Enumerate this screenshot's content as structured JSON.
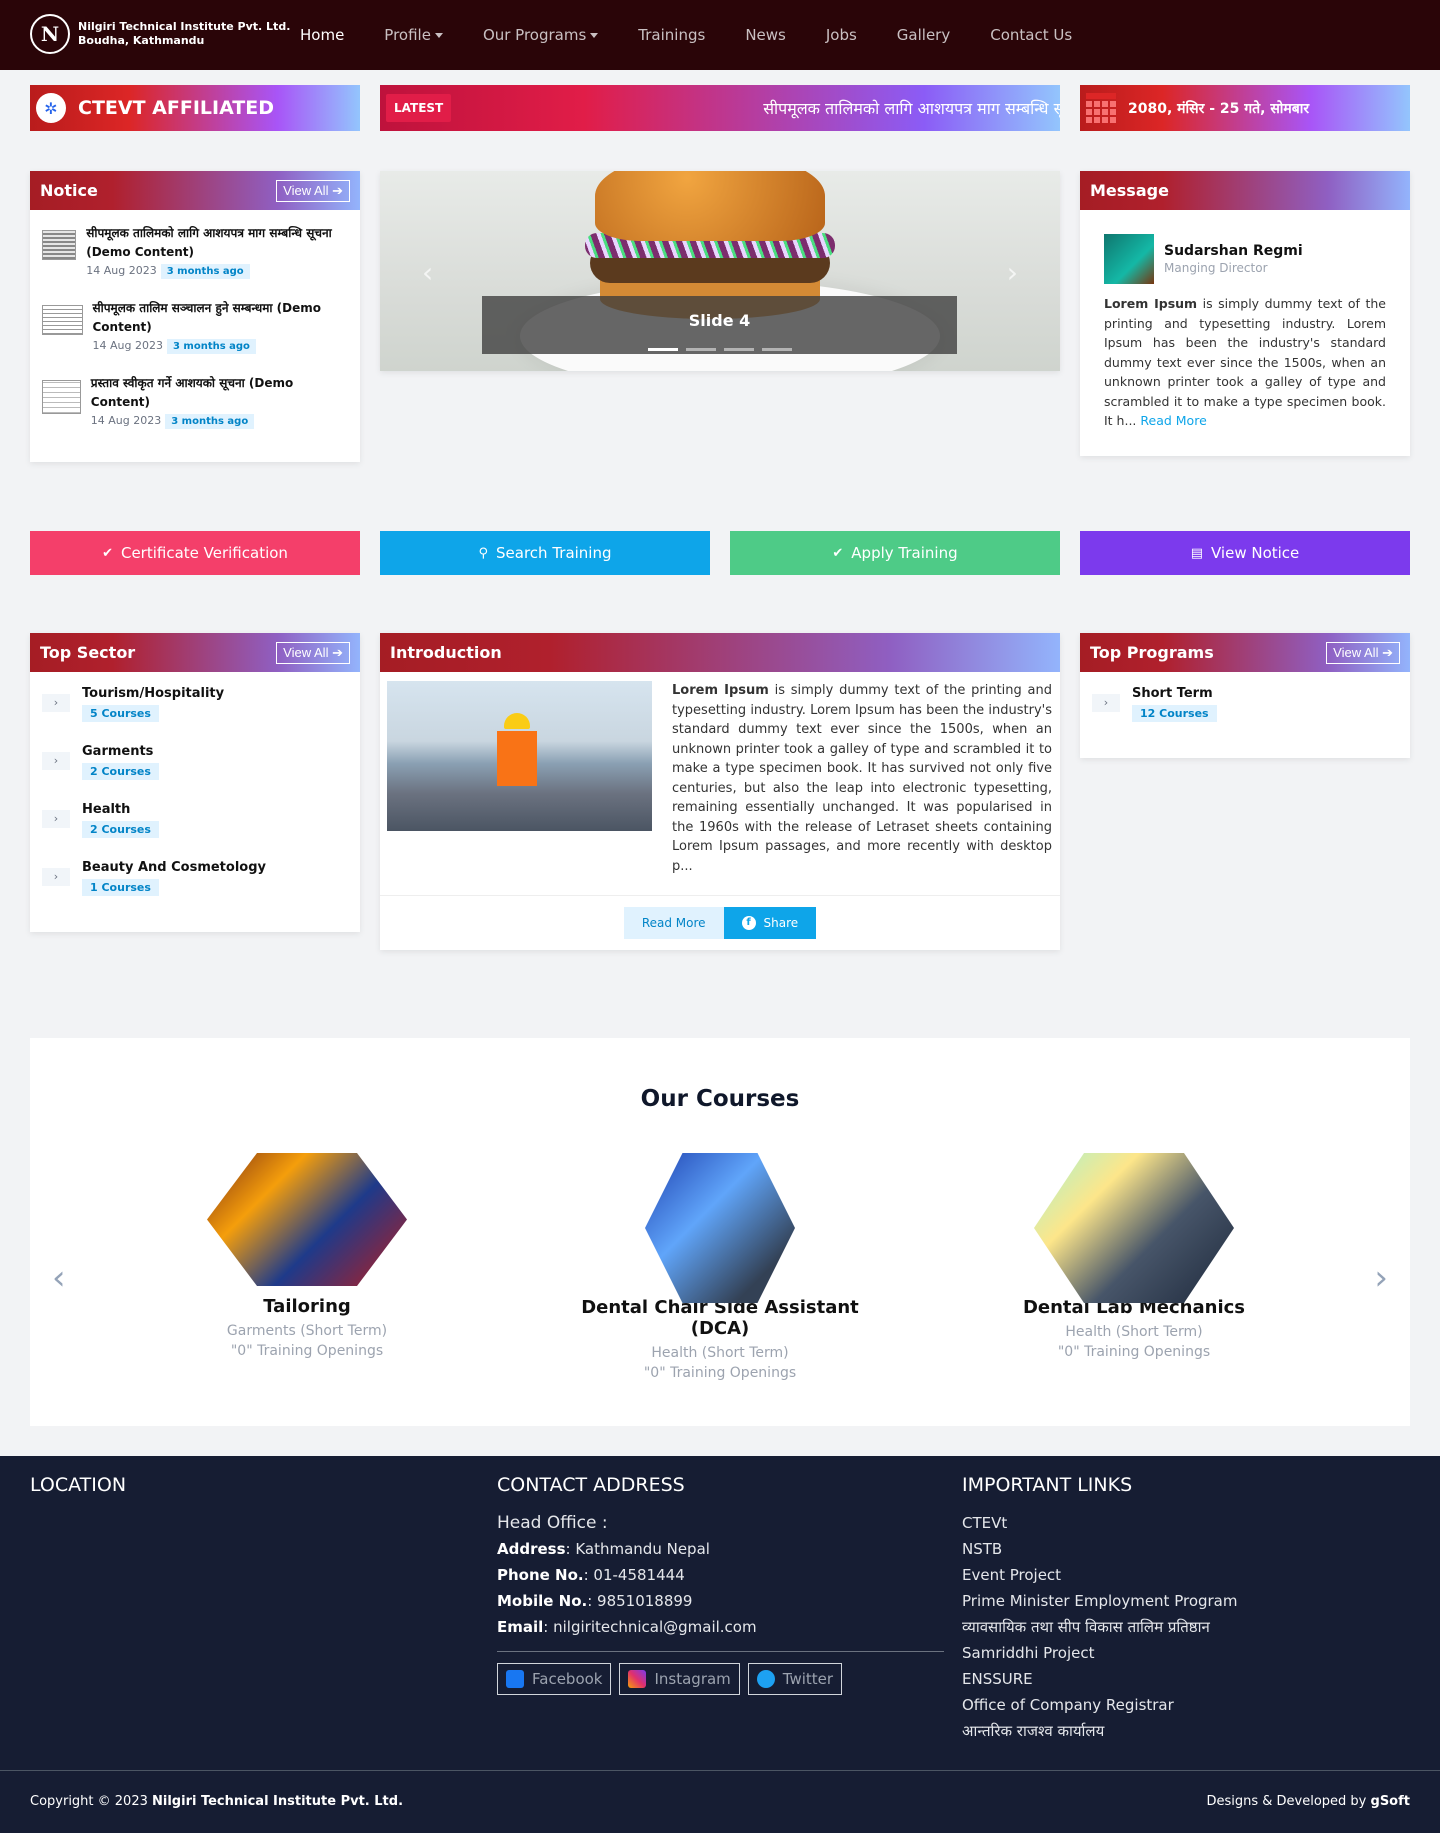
{
  "brand": {
    "name": "Nilgiri Technical Institute Pvt. Ltd.",
    "address": "Boudha, Kathmandu",
    "logo_letter": "N",
    "logo_word": "Nilgiri"
  },
  "nav": [
    {
      "label": "Home",
      "active": true
    },
    {
      "label": "Profile",
      "dropdown": true
    },
    {
      "label": "Our Programs",
      "dropdown": true
    },
    {
      "label": "Trainings"
    },
    {
      "label": "News"
    },
    {
      "label": "Jobs"
    },
    {
      "label": "Gallery"
    },
    {
      "label": "Contact Us"
    }
  ],
  "bars": {
    "ctevt": "CTEVT AFFILIATED",
    "latest_badge": "LATEST",
    "ticker": "सीपमूलक तालिमको लागि आशयपत्र माग सम्बन्धि सूचना",
    "date": "2080, मंसिर - 25 गते, सोमबार"
  },
  "notice": {
    "title": "Notice",
    "view_all": "View All",
    "items": [
      {
        "title": "सीपमूलक तालिमको लागि आशयपत्र माग सम्बन्धि सूचना (Demo Content)",
        "date": "14 Aug 2023",
        "ago": "3 months ago"
      },
      {
        "title": "सीपमूलक तालिम सञ्चालन हुने सम्बन्धमा (Demo Content)",
        "date": "14 Aug 2023",
        "ago": "3 months ago"
      },
      {
        "title": "प्रस्ताव स्वीकृत गर्ने आशयको सूचना (Demo Content)",
        "date": "14 Aug 2023",
        "ago": "3 months ago"
      }
    ]
  },
  "slider": {
    "caption": "Slide 4",
    "prev": "‹",
    "next": "›"
  },
  "message": {
    "title": "Message",
    "name": "Sudarshan Regmi",
    "role": "Manging Director",
    "lead": "Lorem Ipsum",
    "text": " is simply dummy text of the printing and typesetting industry. Lorem Ipsum has been the industry's standard dummy text ever since the 1500s, when an unknown printer took a galley of type and scrambled it to make a type specimen book. It h... ",
    "read_more": "Read More"
  },
  "actions": [
    {
      "label": "Certificate Verification",
      "icon": "✔",
      "color": "#f43f6a"
    },
    {
      "label": "Search Training",
      "icon": "⚲",
      "color": "#0ea5e9"
    },
    {
      "label": "Apply Training",
      "icon": "✔",
      "color": "#4ecb87"
    },
    {
      "label": "View Notice",
      "icon": "▤",
      "color": "#7c3aed"
    }
  ],
  "top_sector": {
    "title": "Top Sector",
    "view_all": "View All",
    "items": [
      {
        "name": "Tourism/Hospitality",
        "count": "5 Courses"
      },
      {
        "name": "Garments",
        "count": "2 Courses"
      },
      {
        "name": "Health",
        "count": "2 Courses"
      },
      {
        "name": "Beauty And Cosmetology",
        "count": "1 Courses"
      }
    ]
  },
  "intro": {
    "title": "Introduction",
    "lead": "Lorem Ipsum",
    "text": " is simply dummy text of the printing and typesetting industry. Lorem Ipsum has been the industry's standard dummy text ever since the 1500s, when an unknown printer took a galley of type and scrambled it to make a type specimen book. It has survived not only five centuries, but also the leap into electronic typesetting, remaining essentially unchanged. It was popularised in the 1960s with the release of Letraset sheets containing Lorem Ipsum passages, and more recently with desktop p...",
    "read_more": "Read More",
    "share": "Share"
  },
  "top_programs": {
    "title": "Top Programs",
    "view_all": "View All",
    "items": [
      {
        "name": "Short Term",
        "count": "12 Courses"
      }
    ]
  },
  "courses": {
    "title": "Our Courses",
    "items": [
      {
        "name": "Tailoring",
        "sector": "Garments (Short Term)",
        "openings": "\"0\" Training Openings"
      },
      {
        "name": "Dental Chair Side Assistant (DCA)",
        "sector": "Health (Short Term)",
        "openings": "\"0\" Training Openings"
      },
      {
        "name": "Dental Lab Mechanics",
        "sector": "Health (Short Term)",
        "openings": "\"0\" Training Openings"
      }
    ]
  },
  "footer": {
    "location_title": "LOCATION",
    "contact_title": "CONTACT ADDRESS",
    "head_office": "Head Office :",
    "address_label": "Address",
    "address": ": Kathmandu Nepal",
    "phone_label": "Phone No.",
    "phone": ": 01-4581444",
    "mobile_label": "Mobile No.",
    "mobile": ": 9851018899",
    "email_label": "Email",
    "email": ": nilgiritechnical@gmail.com",
    "social": [
      {
        "label": "Facebook",
        "color": "#1877f2"
      },
      {
        "label": "Instagram",
        "color": "#e1306c"
      },
      {
        "label": "Twitter",
        "color": "#1da1f2"
      }
    ],
    "links_title": "IMPORTANT LINKS",
    "links": [
      "CTEVt",
      "NSTB",
      "Event Project",
      "Prime Minister Employment Program",
      "व्यावसायिक तथा सीप विकास तालिम प्रतिष्ठान",
      "Samriddhi Project",
      "ENSSURE",
      "Office of Company Registrar",
      "आन्तरिक राजश्व कार्यालय"
    ],
    "copyright_prefix": "Copyright © 2023 ",
    "copyright_name": "Nilgiri Technical Institute Pvt. Ltd.",
    "dev_prefix": "Designs & Developed by ",
    "dev_name": "gSoft"
  }
}
